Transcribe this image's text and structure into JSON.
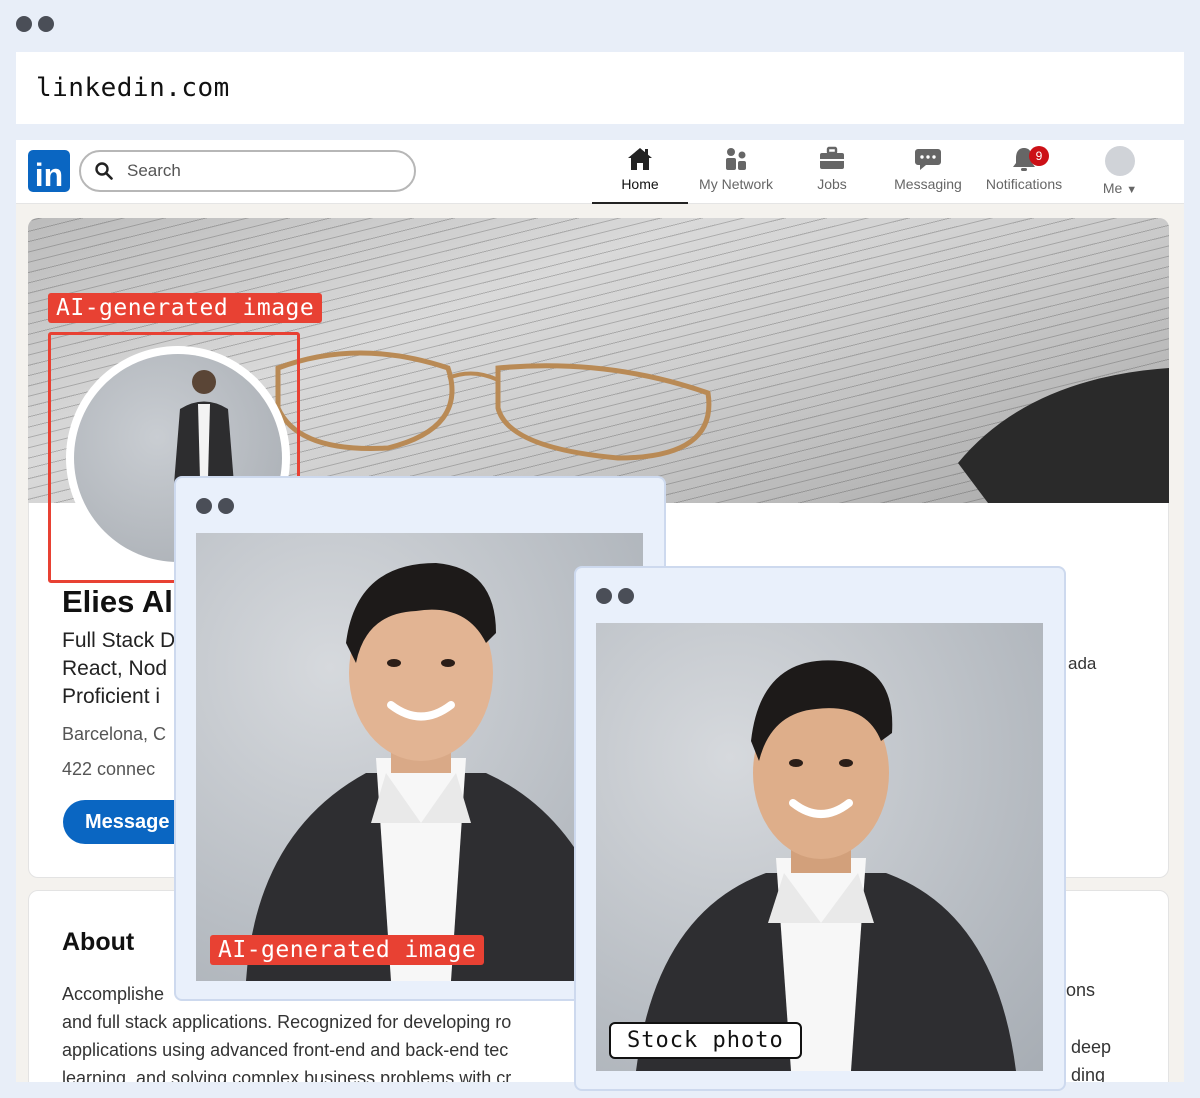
{
  "browser": {
    "url": "linkedin.com"
  },
  "linkedin": {
    "logo": "in",
    "search": {
      "placeholder": "Search"
    },
    "nav": {
      "home": "Home",
      "network": "My Network",
      "jobs": "Jobs",
      "messaging": "Messaging",
      "notifications": "Notifications",
      "notifications_count": "9",
      "me": "Me"
    }
  },
  "profile": {
    "name": "Elies Al",
    "headline": [
      "Full Stack D",
      "React, Nod",
      "Proficient i"
    ],
    "location": "Barcelona, C",
    "connections": "422 connec",
    "message_button": "Message",
    "side_fragment": "ada"
  },
  "about": {
    "title": "About",
    "lines": [
      "Accomplishe",
      "and full stack applications. Recognized for developing ro",
      "applications using advanced front-end and back-end tec",
      "learning, and solving complex business problems with cr"
    ],
    "right_fragments": [
      "ons",
      "deep",
      "ding"
    ]
  },
  "overlays": {
    "ai_label_top": "AI-generated image",
    "ai_label_bottom": "AI-generated image",
    "stock_label": "Stock photo"
  },
  "colors": {
    "linkedin_blue": "#0a66c2",
    "ai_red": "#e84133",
    "notification_red": "#cc1016"
  }
}
